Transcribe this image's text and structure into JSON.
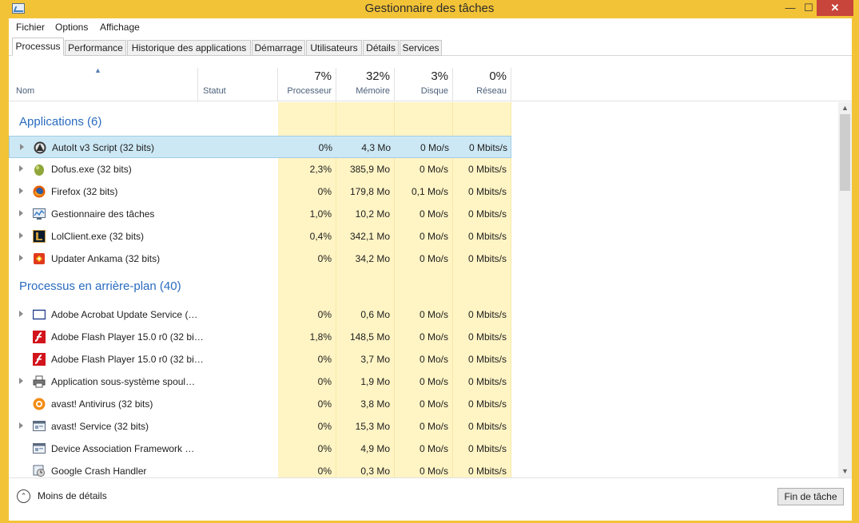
{
  "window": {
    "title": "Gestionnaire des tâches",
    "close_glyph": "✕",
    "min_glyph": "—",
    "max_glyph": "☐"
  },
  "menu": [
    "Fichier",
    "Options",
    "Affichage"
  ],
  "tabs": [
    "Processus",
    "Performance",
    "Historique des applications",
    "Démarrage",
    "Utilisateurs",
    "Détails",
    "Services"
  ],
  "columns": {
    "name": "Nom",
    "status": "Statut",
    "cpu": {
      "pct": "7%",
      "label": "Processeur"
    },
    "memory": {
      "pct": "32%",
      "label": "Mémoire"
    },
    "disk": {
      "pct": "3%",
      "label": "Disque"
    },
    "network": {
      "pct": "0%",
      "label": "Réseau"
    }
  },
  "groups": {
    "apps": "Applications (6)",
    "background": "Processus en arrière-plan (40)"
  },
  "apps": [
    {
      "name": "AutoIt v3 Script (32 bits)",
      "cpu": "0%",
      "mem": "4,3 Mo",
      "disk": "0 Mo/s",
      "net": "0 Mbits/s",
      "icon": "autoit-icon",
      "expand": true
    },
    {
      "name": "Dofus.exe (32 bits)",
      "cpu": "2,3%",
      "mem": "385,9 Mo",
      "disk": "0 Mo/s",
      "net": "0 Mbits/s",
      "icon": "dofus-icon",
      "expand": true
    },
    {
      "name": "Firefox (32 bits)",
      "cpu": "0%",
      "mem": "179,8 Mo",
      "disk": "0,1 Mo/s",
      "net": "0 Mbits/s",
      "icon": "firefox-icon",
      "expand": true
    },
    {
      "name": "Gestionnaire des tâches",
      "cpu": "1,0%",
      "mem": "10,2 Mo",
      "disk": "0 Mo/s",
      "net": "0 Mbits/s",
      "icon": "task-manager-icon",
      "expand": true
    },
    {
      "name": "LolClient.exe (32 bits)",
      "cpu": "0,4%",
      "mem": "342,1 Mo",
      "disk": "0 Mo/s",
      "net": "0 Mbits/s",
      "icon": "lol-icon",
      "expand": true
    },
    {
      "name": "Updater Ankama (32 bits)",
      "cpu": "0%",
      "mem": "34,2 Mo",
      "disk": "0 Mo/s",
      "net": "0 Mbits/s",
      "icon": "ankama-icon",
      "expand": true
    }
  ],
  "background": [
    {
      "name": "Adobe Acrobat Update Service (…",
      "cpu": "0%",
      "mem": "0,6 Mo",
      "disk": "0 Mo/s",
      "net": "0 Mbits/s",
      "icon": "window-icon",
      "expand": true
    },
    {
      "name": "Adobe Flash Player 15.0 r0 (32 bi…",
      "cpu": "1,8%",
      "mem": "148,5 Mo",
      "disk": "0 Mo/s",
      "net": "0 Mbits/s",
      "icon": "flash-icon",
      "expand": false
    },
    {
      "name": "Adobe Flash Player 15.0 r0 (32 bi…",
      "cpu": "0%",
      "mem": "3,7 Mo",
      "disk": "0 Mo/s",
      "net": "0 Mbits/s",
      "icon": "flash-icon",
      "expand": false
    },
    {
      "name": "Application sous-système spoul…",
      "cpu": "0%",
      "mem": "1,9 Mo",
      "disk": "0 Mo/s",
      "net": "0 Mbits/s",
      "icon": "printer-icon",
      "expand": true
    },
    {
      "name": "avast! Antivirus (32 bits)",
      "cpu": "0%",
      "mem": "3,8 Mo",
      "disk": "0 Mo/s",
      "net": "0 Mbits/s",
      "icon": "avast-icon",
      "expand": false
    },
    {
      "name": "avast! Service (32 bits)",
      "cpu": "0%",
      "mem": "15,3 Mo",
      "disk": "0 Mo/s",
      "net": "0 Mbits/s",
      "icon": "service-icon",
      "expand": true
    },
    {
      "name": "Device Association Framework …",
      "cpu": "0%",
      "mem": "4,9 Mo",
      "disk": "0 Mo/s",
      "net": "0 Mbits/s",
      "icon": "service-icon",
      "expand": false
    },
    {
      "name": "Google Crash Handler",
      "cpu": "0%",
      "mem": "0,3 Mo",
      "disk": "0 Mo/s",
      "net": "0 Mbits/s",
      "icon": "crash-handler-icon",
      "expand": false
    }
  ],
  "footer": {
    "less_details": "Moins de détails",
    "end_task": "Fin de tâche"
  }
}
